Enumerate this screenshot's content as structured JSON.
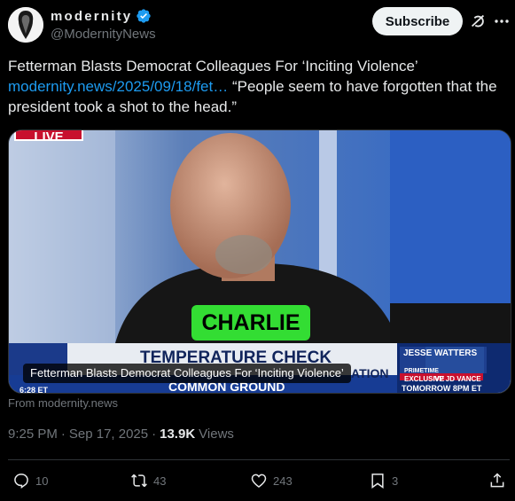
{
  "account": {
    "display_name": "modernity",
    "handle": "@ModernityNews",
    "verified": true
  },
  "header": {
    "subscribe_label": "Subscribe",
    "grok_icon": "grok-icon",
    "more_icon": "more-icon"
  },
  "tweet": {
    "text_line1": "Fetterman Blasts Democrat Colleagues For ‘Inciting Violence’",
    "link_text": "modernity.news/2025/09/18/fet…",
    "quote_text": " “People seem to have forgotten that the president took a shot to the head.”"
  },
  "card": {
    "caption": "Fetterman Blasts Democrat Colleagues For ‘Inciting Violence’",
    "source": "From modernity.news",
    "live_label": "LIVE",
    "overlay_word": "CHARLIE",
    "chyron_title": "TEMPERATURE CHECK",
    "chyron_subtitle": "COMMON GROUND",
    "chyron_right": "ATION",
    "promo_line1": "JESSE WATTERS",
    "promo_primetime": "PRIMETIME",
    "promo_exclusive": "EXCLUSIVE",
    "promo_guest": "VP JD VANCE",
    "promo_time": "TOMORROW 8PM ET",
    "clock": "6:28 ET"
  },
  "meta": {
    "time": "9:25 PM",
    "date": "Sep 17, 2025",
    "views_count": "13.9K",
    "views_label": "Views",
    "separator": "·"
  },
  "actions": {
    "replies": "10",
    "reposts": "43",
    "likes": "243",
    "bookmarks": "3"
  },
  "colors": {
    "accent": "#1d9bf0",
    "text": "#e7e9ea",
    "muted": "#71767b",
    "background": "#000000"
  }
}
